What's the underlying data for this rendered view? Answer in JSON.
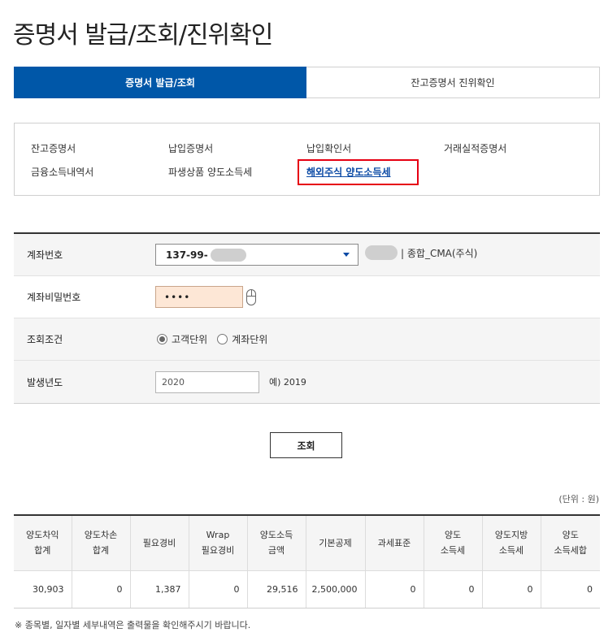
{
  "page_title": "증명서 발급/조회/진위확인",
  "tabs": [
    {
      "label": "증명서 발급/조회",
      "active": true
    },
    {
      "label": "잔고증명서 진위확인",
      "active": false
    }
  ],
  "cert_links": [
    {
      "label": "잔고증명서"
    },
    {
      "label": "납입증명서"
    },
    {
      "label": "납입확인서"
    },
    {
      "label": "거래실적증명서"
    },
    {
      "label": "금융소득내역서"
    },
    {
      "label": "파생상품 양도소득세"
    },
    {
      "label": "해외주식 양도소득세",
      "selected": true
    }
  ],
  "form": {
    "account_label": "계좌번호",
    "account_value": "137-99-",
    "account_type": "| 종합_CMA(주식)",
    "password_label": "계좌비밀번호",
    "password_value": "••••",
    "condition_label": "조회조건",
    "condition_options": [
      "고객단위",
      "계좌단위"
    ],
    "condition_selected": "고객단위",
    "year_label": "발생년도",
    "year_placeholder": "2020",
    "year_hint": "예) 2019"
  },
  "query_button": "조회",
  "unit_text": "(단위 : 원)",
  "table": {
    "headers": [
      [
        "양도차익",
        "합계"
      ],
      [
        "양도차손",
        "합계"
      ],
      [
        "필요경비"
      ],
      [
        "Wrap",
        "필요경비"
      ],
      [
        "양도소득",
        "금액"
      ],
      [
        "기본공제"
      ],
      [
        "과세표준"
      ],
      [
        "양도",
        "소득세"
      ],
      [
        "양도지방",
        "소득세"
      ],
      [
        "양도",
        "소득세합"
      ]
    ],
    "row": [
      "30,903",
      "0",
      "1,387",
      "0",
      "29,516",
      "2,500,000",
      "0",
      "0",
      "0",
      "0"
    ]
  },
  "footnote": "※ 종목별, 일자별 세부내역은 출력물을 확인해주시기 바랍니다."
}
